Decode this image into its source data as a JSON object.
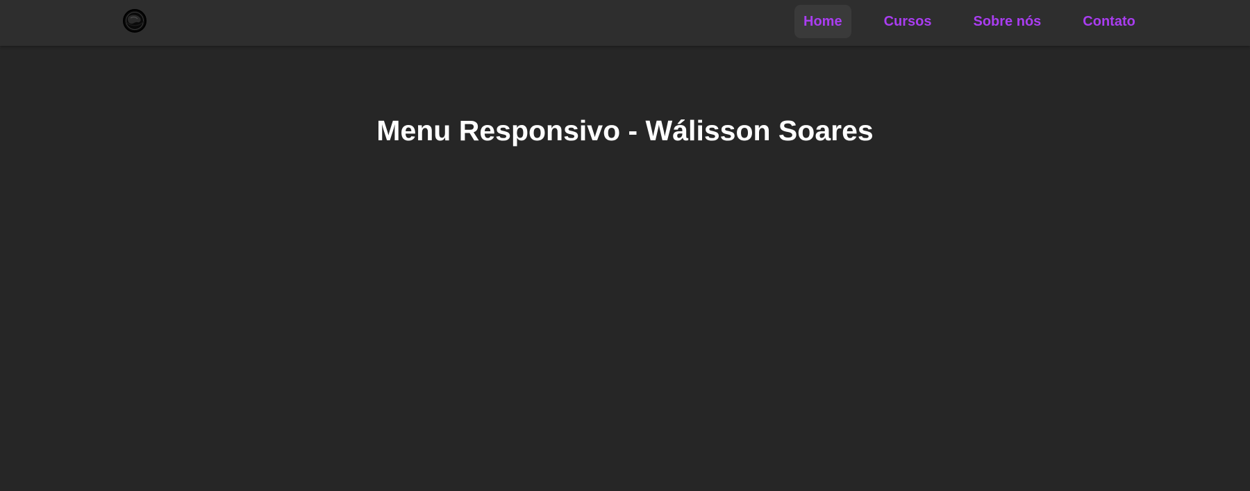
{
  "header": {
    "logo_icon": "planet-logo-icon",
    "nav": [
      {
        "label": "Home",
        "active": true
      },
      {
        "label": "Cursos",
        "active": false
      },
      {
        "label": "Sobre nós",
        "active": false
      },
      {
        "label": "Contato",
        "active": false
      }
    ]
  },
  "main": {
    "title": "Menu Responsivo - Wálisson Soares"
  },
  "colors": {
    "background": "#262626",
    "navbar": "#2e2e2e",
    "link": "#a93df0",
    "active_bg": "#3a3a3a",
    "title": "#ffffff"
  }
}
